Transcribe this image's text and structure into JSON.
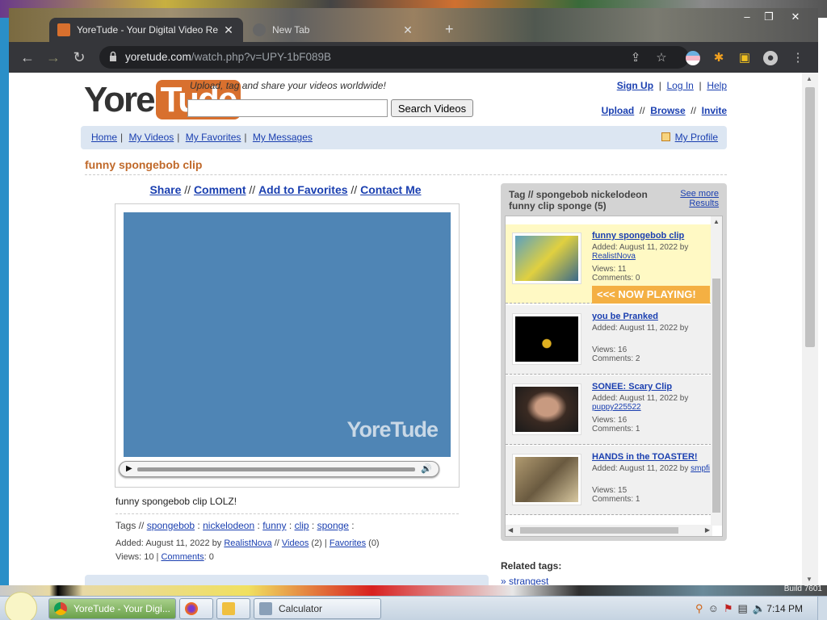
{
  "browser": {
    "tabs": [
      {
        "title": "YoreTude - Your Digital Video Re",
        "active": true
      },
      {
        "title": "New Tab",
        "active": false
      }
    ],
    "new_tab_symbol": "+",
    "url_host": "yoretude.com",
    "url_path": "/watch.php?v=UPY-1bF089B",
    "window_controls": [
      "minimize-icon",
      "restore-icon",
      "close-icon"
    ],
    "toolbar_icons": [
      "back-icon",
      "forward-icon",
      "reload-icon",
      "lock-icon",
      "share-icon",
      "star-icon",
      "extension-icon",
      "puzzle-icon",
      "sidepanel-icon",
      "profile-icon",
      "menu-icon"
    ]
  },
  "site": {
    "logo_left": "Yore",
    "logo_right": "Tude",
    "tagline": "Upload, tag and share your videos worldwide!",
    "search_value": "",
    "search_button": "Search Videos",
    "top_links": [
      "Sign Up",
      "Log In",
      "Help"
    ],
    "top_links_2": [
      "Upload",
      "Browse",
      "Invite"
    ],
    "nav": [
      "Home",
      "My Videos",
      "My Favorites",
      "My Messages"
    ],
    "my_profile": "My Profile"
  },
  "video": {
    "title": "funny spongebob clip",
    "actions": [
      "Share",
      "Comment",
      "Add to Favorites",
      "Contact Me"
    ],
    "watermark": "YoreTude",
    "description": "funny spongebob clip LOLZ!",
    "tags_label": "Tags //",
    "tags": [
      "spongebob",
      "nickelodeon",
      "funny",
      "clip",
      "sponge"
    ],
    "added_text": "Added: August 11, 2022 by",
    "added_user": "RealistNova",
    "videos_link": "Videos",
    "videos_count": "(2)",
    "favorites_link": "Favorites",
    "favorites_count": "(0)",
    "views_text": "Views: 10 |",
    "comments_link": "Comments",
    "comments_count": ": 0"
  },
  "sidebar": {
    "heading": "Tag // spongebob nickelodeon funny clip sponge (5)",
    "see_more": "See more",
    "results": "Results",
    "now_playing": "<<< NOW PLAYING!",
    "items": [
      {
        "title": "funny spongebob clip",
        "added": "Added: August 11, 2022 by",
        "user": "RealistNova",
        "views": "Views: 11",
        "comments": "Comments: 0",
        "active": true
      },
      {
        "title": "you be Pranked",
        "added": "Added: August 11, 2022 by",
        "user": "",
        "views": "Views: 16",
        "comments": "Comments: 2",
        "active": false
      },
      {
        "title": "SONEE: Scary Clip",
        "added": "Added: August 11, 2022 by",
        "user": "puppy225522",
        "views": "Views: 16",
        "comments": "Comments: 1",
        "active": false
      },
      {
        "title": "HANDS in the TOASTER!",
        "added": "Added: August 11, 2022 by",
        "user": "smpfi",
        "views": "Views: 15",
        "comments": "Comments: 1",
        "active": false
      }
    ],
    "related_label": "Related tags:",
    "related_first": "» strangest"
  },
  "taskbar": {
    "tasks": [
      "YoreTude - Your Digi...",
      "Calculator"
    ],
    "clock": "7:14 PM",
    "build": "Build 7601"
  }
}
